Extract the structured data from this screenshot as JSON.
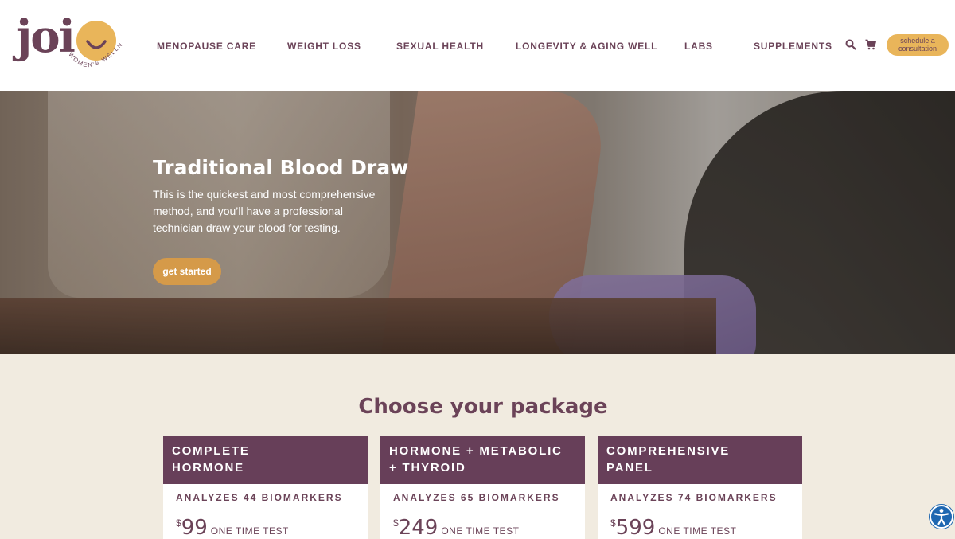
{
  "brand": {
    "name": "joi",
    "tagline": "WOMEN'S WELLNESS"
  },
  "nav": {
    "items": [
      {
        "label": "MENOPAUSE CARE"
      },
      {
        "label": "WEIGHT LOSS"
      },
      {
        "label": "SEXUAL HEALTH"
      },
      {
        "label": "LONGEVITY & AGING WELL"
      },
      {
        "label": "LABS"
      },
      {
        "label": "SUPPLEMENTS"
      }
    ],
    "consult_line1": "schedule a",
    "consult_line2": "consultation"
  },
  "hero": {
    "title": "Traditional Blood Draw",
    "text": "This is the quickest and most comprehensive method, and you’ll have a professional technician draw your blood for testing.",
    "cta_label": "get started"
  },
  "packages": {
    "title": "Choose your package",
    "items": [
      {
        "name_line1": "COMPLETE",
        "name_line2": "HORMONE",
        "biomarkers": "ANALYZES 44 BIOMARKERS",
        "currency": "$",
        "price": "99",
        "price_note": "ONE TIME TEST"
      },
      {
        "name_line1": "HORMONE + METABOLIC",
        "name_line2": "+ THYROID",
        "biomarkers": "ANALYZES 65 BIOMARKERS",
        "currency": "$",
        "price": "249",
        "price_note": "ONE TIME TEST"
      },
      {
        "name_line1": "COMPREHENSIVE",
        "name_line2": "PANEL",
        "biomarkers": "ANALYZES 74 BIOMARKERS",
        "currency": "$",
        "price": "599",
        "price_note": "ONE TIME TEST"
      }
    ]
  },
  "icons": {
    "search": "search-icon",
    "cart": "cart-icon",
    "accessibility": "accessibility-icon"
  },
  "colors": {
    "brand_plum": "#6b4358",
    "header_plum": "#673f59",
    "accent_gold": "#e9b55a",
    "cta_orange": "#d59a49",
    "background_cream": "#f1ebe0"
  }
}
